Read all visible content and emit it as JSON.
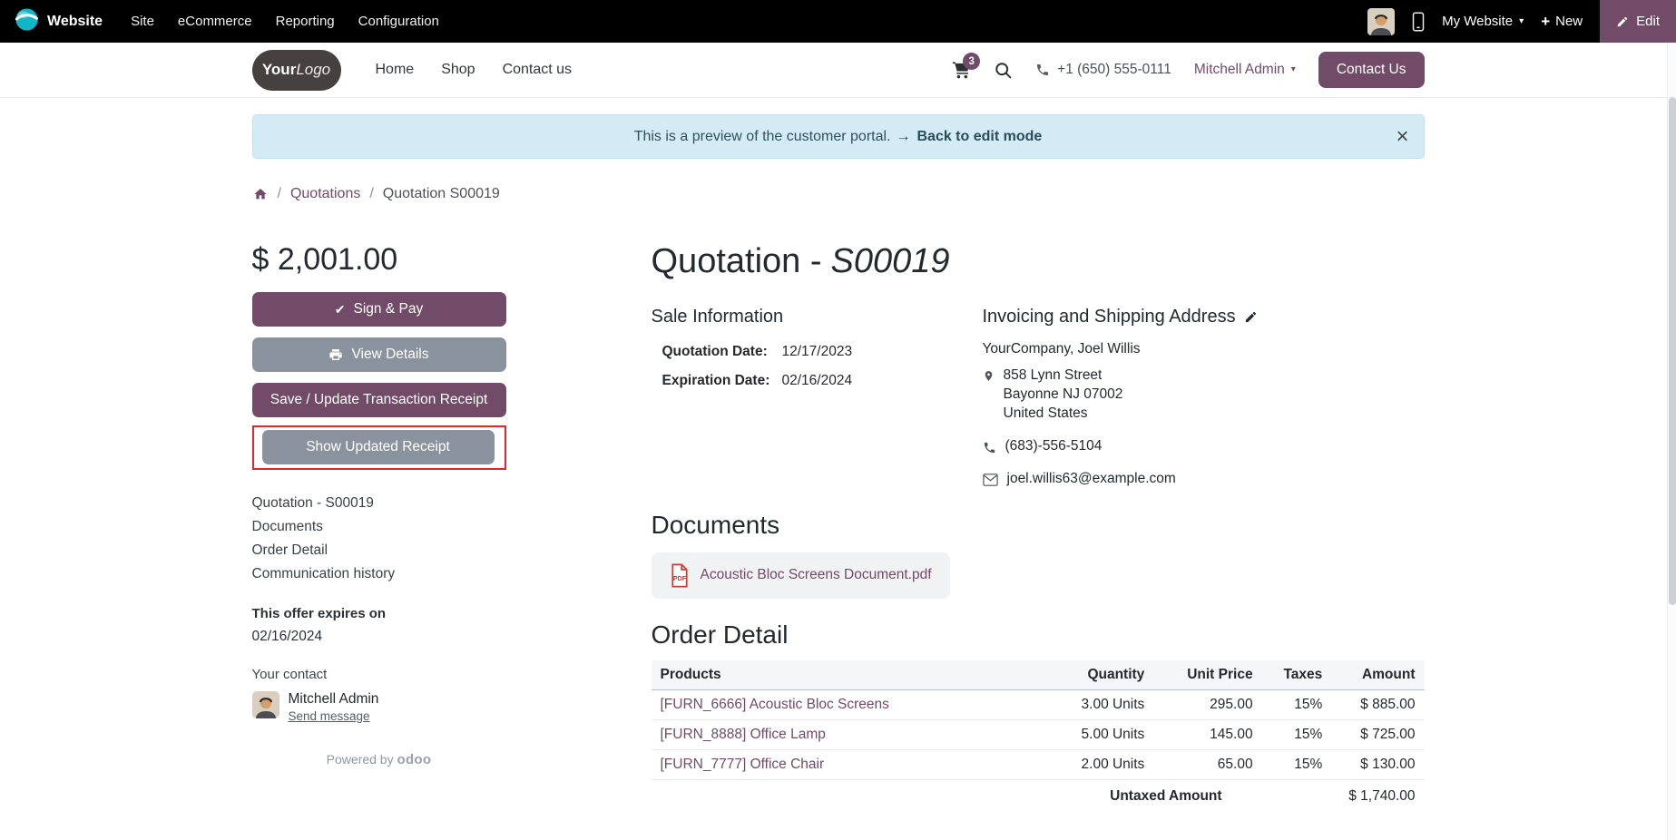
{
  "colors": {
    "primary": "#714B67",
    "secondary_button": "#8a939d",
    "topbar_bg": "#000000",
    "banner_bg": "#d2ebf4",
    "highlight_box": "#e3242b",
    "pdf_icon": "#d23b33"
  },
  "icons": {
    "plus": "+",
    "caret": "▾",
    "check": "✔"
  },
  "backend_nav": {
    "app": "Website",
    "menus": [
      "Site",
      "eCommerce",
      "Reporting",
      "Configuration"
    ],
    "my_website": "My Website",
    "new": "New",
    "edit": "Edit"
  },
  "site_header": {
    "logo_your": "Your",
    "logo_logo": "Logo",
    "nav": [
      "Home",
      "Shop",
      "Contact us"
    ],
    "cart_badge": "3",
    "phone": "+1 (650) 555-0111",
    "user": "Mitchell Admin",
    "contact_button": "Contact Us"
  },
  "banner": {
    "message": "This is a preview of the customer portal.",
    "arrow": "→",
    "action": "Back to edit mode",
    "close": "×"
  },
  "breadcrumb": {
    "separator": "/",
    "link": "Quotations",
    "current": "Quotation S00019"
  },
  "sidebar": {
    "amount": "$ 2,001.00",
    "buttons": {
      "sign_pay": "Sign & Pay",
      "view_details": "View Details",
      "save_receipt": "Save / Update Transaction Receipt",
      "show_receipt": "Show Updated Receipt"
    },
    "links": [
      "Quotation - S00019",
      "Documents",
      "Order Detail",
      "Communication history"
    ],
    "expires_label": "This offer expires on",
    "expires_date": "02/16/2024",
    "contact_label": "Your contact",
    "contact_name": "Mitchell Admin",
    "send_message": "Send message",
    "powered_by": "Powered by",
    "brand": "odoo"
  },
  "quotation": {
    "title_prefix": "Quotation -",
    "title_number": "S00019",
    "sale_information": {
      "heading": "Sale Information",
      "quotation_date_label": "Quotation Date:",
      "quotation_date": "12/17/2023",
      "expiration_date_label": "Expiration Date:",
      "expiration_date": "02/16/2024"
    },
    "address": {
      "heading": "Invoicing and Shipping Address",
      "name": "YourCompany, Joel Willis",
      "street": "858 Lynn Street",
      "city": "Bayonne NJ 07002",
      "country": "United States",
      "phone": "(683)-556-5104",
      "email": "joel.willis63@example.com"
    },
    "documents": {
      "heading": "Documents",
      "file_name": "Acoustic Bloc Screens Document.pdf"
    },
    "order_detail": {
      "heading": "Order Detail",
      "columns": [
        "Products",
        "Quantity",
        "Unit Price",
        "Taxes",
        "Amount"
      ],
      "rows": [
        {
          "product": "[FURN_6666] Acoustic Bloc Screens",
          "quantity": "3.00 Units",
          "unit_price": "295.00",
          "taxes": "15%",
          "amount": "$ 885.00"
        },
        {
          "product": "[FURN_8888] Office Lamp",
          "quantity": "5.00 Units",
          "unit_price": "145.00",
          "taxes": "15%",
          "amount": "$ 725.00"
        },
        {
          "product": "[FURN_7777] Office Chair",
          "quantity": "2.00 Units",
          "unit_price": "65.00",
          "taxes": "15%",
          "amount": "$ 130.00"
        }
      ],
      "untaxed_label": "Untaxed Amount",
      "untaxed_amount": "$ 1,740.00"
    }
  }
}
